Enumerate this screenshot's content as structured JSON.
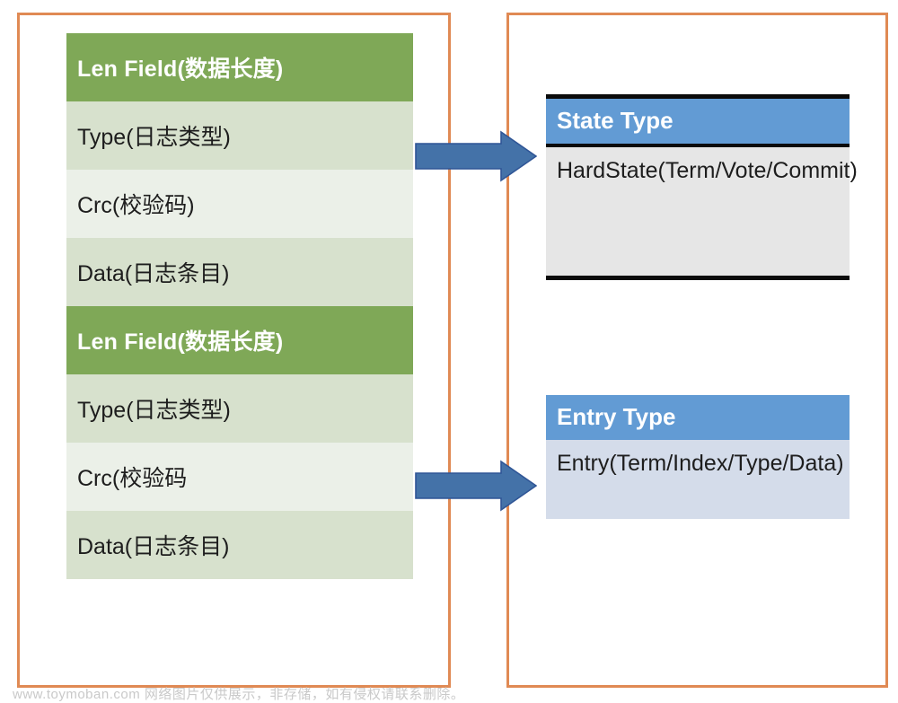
{
  "diagram": {
    "left_panel": {
      "name": "log-record-layout",
      "groups": [
        {
          "header": "Len Field(数据长度)",
          "fields": [
            "Type(日志类型)",
            "Crc(校验码)",
            "Data(日志条目)"
          ]
        },
        {
          "header": "Len Field(数据长度)",
          "fields": [
            "Type(日志类型)",
            "Crc(校验码",
            "Data(日志条目)"
          ]
        }
      ]
    },
    "right_panel": {
      "name": "raft-type-boxes",
      "boxes": [
        {
          "title": "State Type",
          "body": "HardState(Term/Vote/Commit)"
        },
        {
          "title": "Entry Type",
          "body": "Entry(Term/Index/Type/Data)"
        }
      ]
    },
    "arrows": [
      {
        "name": "arrow-to-state-type",
        "direction": "right"
      },
      {
        "name": "arrow-to-entry-type",
        "direction": "right"
      }
    ],
    "colors": {
      "frame_orange": "#e08a54",
      "header_green": "#7fa857",
      "row_shade_dark": "#d7e1cd",
      "row_shade_light": "#ebf0e8",
      "header_blue": "#629bd4",
      "state_body_gray": "#e6e6e6",
      "entry_body_blue": "#d4dcea",
      "arrow_fill": "#4472a8",
      "arrow_stroke": "#2f5596"
    }
  },
  "watermark": {
    "text": "www.toymoban.com 网络图片仅供展示，非存储，如有侵权请联系删除。"
  }
}
